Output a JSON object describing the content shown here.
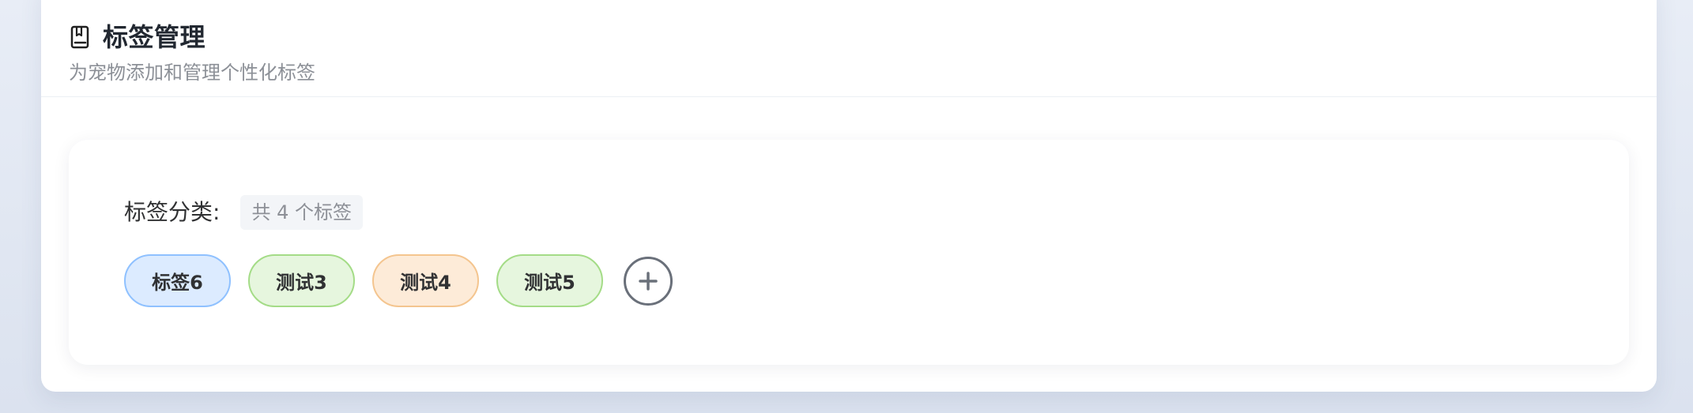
{
  "header": {
    "title": "标签管理",
    "subtitle": "为宠物添加和管理个性化标签",
    "icon": "book-icon"
  },
  "category": {
    "label": "标签分类:",
    "count_text": "共 4 个标签"
  },
  "tags": [
    {
      "label": "标签6",
      "color": "#dcebff",
      "border_color": "#8fc1ff"
    },
    {
      "label": "测试3",
      "color": "#e6f6de",
      "border_color": "#a4dc87"
    },
    {
      "label": "测试4",
      "color": "#fdebd8",
      "border_color": "#f4c58f"
    },
    {
      "label": "测试5",
      "color": "#e6f6de",
      "border_color": "#a4dc87"
    }
  ],
  "add_button": {
    "icon": "plus-icon"
  }
}
